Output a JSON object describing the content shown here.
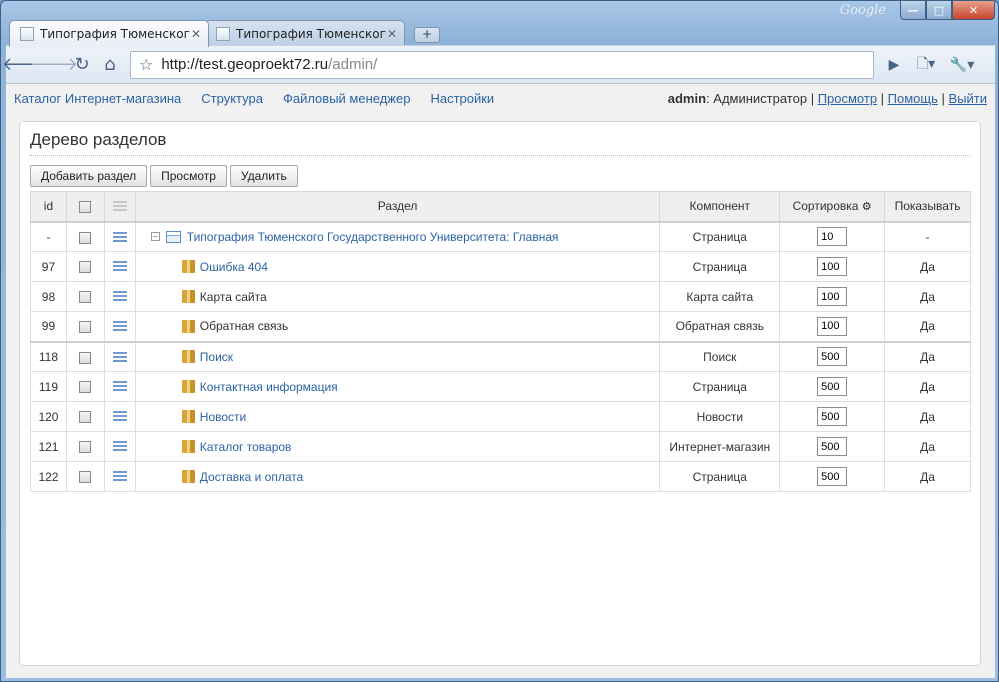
{
  "browser": {
    "brand": "Google",
    "tabs": [
      {
        "title": "Типография Тюменског...",
        "active": true
      },
      {
        "title": "Типография Тюменског...",
        "active": false
      }
    ],
    "url": {
      "host": "http://test.geoproekt72.ru",
      "path": "/admin/"
    }
  },
  "admin_menu": {
    "items": [
      "Каталог Интернет-магазина",
      "Структура",
      "Файловый менеджер",
      "Настройки"
    ],
    "user": {
      "login": "admin",
      "role": ": Администратор",
      "sep": " | ",
      "links": [
        "Просмотр",
        "Помощь",
        "Выйти"
      ]
    }
  },
  "panel": {
    "title": "Дерево разделов",
    "buttons": {
      "add": "Добавить раздел",
      "view": "Просмотр",
      "delete": "Удалить"
    },
    "columns": {
      "id": "id",
      "section": "Раздел",
      "component": "Компонент",
      "sort": "Сортировка",
      "show": "Показывать"
    },
    "rows": [
      {
        "id": "-",
        "name": "Типография Тюменского Государственного Университета: Главная",
        "component": "Страница",
        "sort": "10",
        "show": "-",
        "link": true,
        "root": true
      },
      {
        "id": "97",
        "name": "Ошибка 404",
        "component": "Страница",
        "sort": "100",
        "show": "Да",
        "link": true
      },
      {
        "id": "98",
        "name": "Карта сайта",
        "component": "Карта сайта",
        "sort": "100",
        "show": "Да",
        "link": false
      },
      {
        "id": "99",
        "name": "Обратная связь",
        "component": "Обратная связь",
        "sort": "100",
        "show": "Да",
        "link": false
      },
      {
        "id": "118",
        "name": "Поиск",
        "component": "Поиск",
        "sort": "500",
        "show": "Да",
        "link": true
      },
      {
        "id": "119",
        "name": "Контактная информация",
        "component": "Страница",
        "sort": "500",
        "show": "Да",
        "link": true
      },
      {
        "id": "120",
        "name": "Новости",
        "component": "Новости",
        "sort": "500",
        "show": "Да",
        "link": true
      },
      {
        "id": "121",
        "name": "Каталог товаров",
        "component": "Интернет-магазин",
        "sort": "500",
        "show": "Да",
        "link": true
      },
      {
        "id": "122",
        "name": "Доставка и оплата",
        "component": "Страница",
        "sort": "500",
        "show": "Да",
        "link": true
      }
    ]
  }
}
